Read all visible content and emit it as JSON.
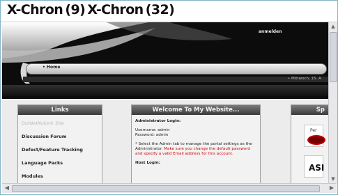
{
  "caption": "X-Chron (9) X-Chron (32)",
  "site": {
    "header_link": "anmelden",
    "nav_home": "• Home",
    "subbar_text": "• Mittwoch, 15. A",
    "panels": {
      "links": {
        "title": "Links",
        "items": [
          "DotNetNuke® Site",
          "Discussion Forum",
          "Defect/Feature Tracking",
          "Language Packs",
          "Modules"
        ]
      },
      "welcome": {
        "title": "Welcome To My Website...",
        "admin_login_label": "Administrator Login:",
        "username_line": "Username: admin",
        "password_line": "Password: admin",
        "note_black": "* Select the Admin tab to manage the portal settings as the Administrator.",
        "note_red": "Make sure you change the default password and specify a valid Email address for this account.",
        "host_login_label": "Host Login:"
      },
      "right": {
        "title": "Sp",
        "ad_top_text": "Per",
        "ad_bottom_text": "ASI"
      }
    }
  },
  "colors": {
    "header_bg": "#0c0c0c",
    "panel_title": "#5a5a5a",
    "warning_text": "#d00000"
  }
}
